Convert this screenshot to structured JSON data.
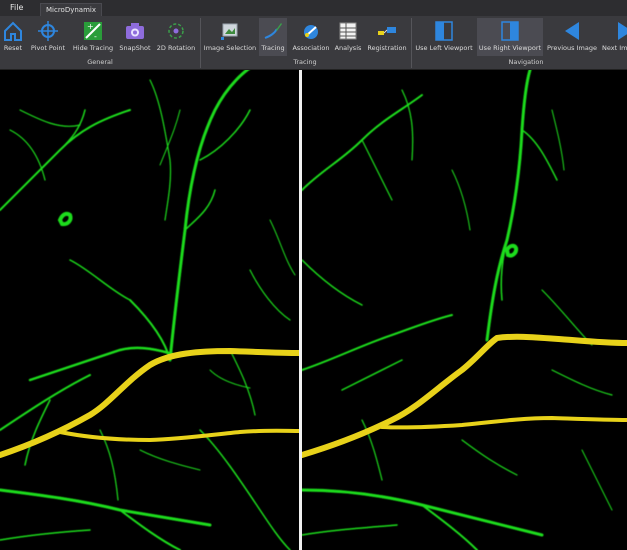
{
  "menu": {
    "file": "File"
  },
  "tab": {
    "title": "MicroDynamix"
  },
  "ribbon": {
    "groups": {
      "general": "General",
      "tracing": "Tracing",
      "navigation": "Navigation"
    },
    "buttons": {
      "reset": "Reset",
      "pivot_point": "Pivot Point",
      "hide_tracing": "Hide Tracing",
      "snapshot": "SnapShot",
      "rotation_2d": "2D Rotation",
      "image_selection": "Image Selection",
      "tracing": "Tracing",
      "association": "Association",
      "analysis": "Analysis",
      "registration": "Registration",
      "use_left_viewport": "Use Left Viewport",
      "use_right_viewport": "Use Right Viewport",
      "previous_image": "Previous Image",
      "next_image": "Next Image"
    }
  },
  "colors": {
    "neuron_green": "#1fdc1f",
    "trace_yellow": "#e8d21a",
    "icon_blue": "#2e86de",
    "ribbon_bg": "#3a3a3e"
  }
}
